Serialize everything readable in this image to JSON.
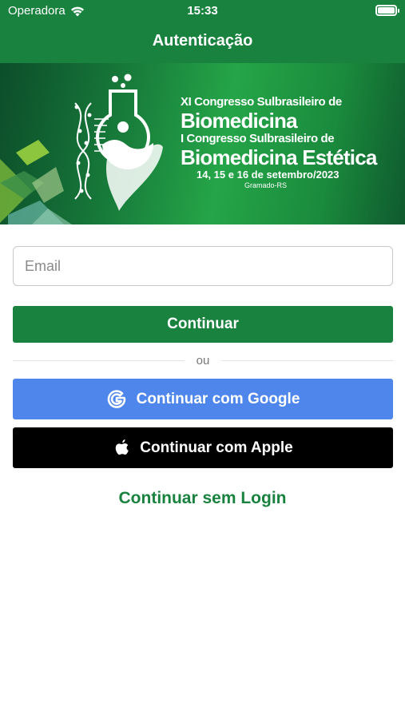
{
  "status_bar": {
    "carrier": "Operadora",
    "time": "15:33",
    "battery_level": 1.0
  },
  "nav": {
    "title": "Autenticação"
  },
  "banner": {
    "line1": "XI Congresso Sulbrasileiro de",
    "line2": "Biomedicina",
    "line3": "I Congresso Sulbrasileiro de",
    "line4": "Biomedicina Estética",
    "dates": "14, 15 e 16 de setembro/2023",
    "location": "Gramado-RS"
  },
  "form": {
    "email_placeholder": "Email",
    "email_value": "",
    "continue_label": "Continuar",
    "divider_label": "ou",
    "google_label": "Continuar com Google",
    "apple_label": "Continuar com Apple",
    "skip_label": "Continuar sem Login"
  },
  "colors": {
    "primary": "#19823f",
    "google": "#4f86ec",
    "apple": "#000000"
  },
  "icons": [
    "wifi-icon",
    "battery-icon",
    "google-icon",
    "apple-icon",
    "congress-logo-icon"
  ]
}
